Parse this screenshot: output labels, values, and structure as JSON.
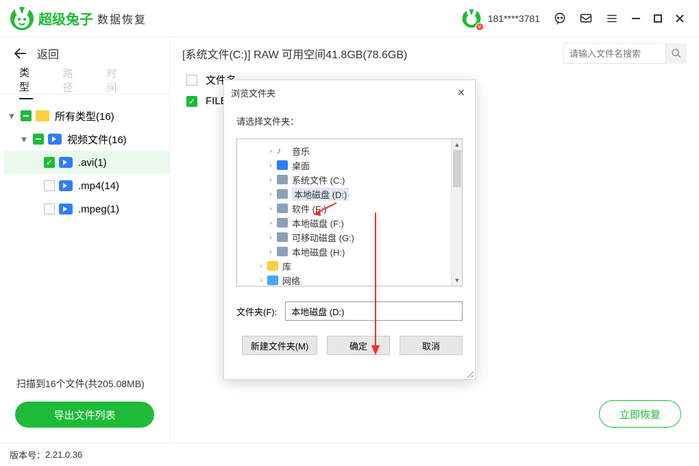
{
  "header": {
    "app_name": "超级兔子",
    "app_suffix": "数据恢复",
    "phone": "181****3781"
  },
  "back_label": "返回",
  "tabs": {
    "type": "类型",
    "path": "路径",
    "time": "时间"
  },
  "tree": {
    "all_label": "所有类型(16)",
    "video_label": "视频文件(16)",
    "avi_label": ".avi(1)",
    "mp4_label": ".mp4(14)",
    "mpeg_label": ".mpeg(1)"
  },
  "scan_info": "扫描到16个文件(共205.08MB)",
  "export_btn": "导出文件列表",
  "main": {
    "path": "[系统文件(C:)] RAW 可用空间41.8GB(78.6GB)",
    "search_placeholder": "请输入文件名搜索",
    "col_name": "文件名",
    "row_file": "FILE",
    "recover_btn": "立即恢复"
  },
  "footer": {
    "version_label": "版本号：",
    "version": "2.21.0.36"
  },
  "dialog": {
    "title": "浏览文件夹",
    "prompt": "请选择文件夹：",
    "items": {
      "music": "音乐",
      "desktop": "桌面",
      "c": "系统文件 (C:)",
      "d": "本地磁盘 (D:)",
      "e": "软件 (E:)",
      "f": "本地磁盘 (F:)",
      "g": "可移动磁盘 (G:)",
      "h": "本地磁盘 (H:)",
      "lib": "库",
      "net": "网络"
    },
    "field_label": "文件夹(F):",
    "field_value": "本地磁盘 (D:)",
    "btn_new": "新建文件夹(M)",
    "btn_ok": "确定",
    "btn_cancel": "取消"
  }
}
